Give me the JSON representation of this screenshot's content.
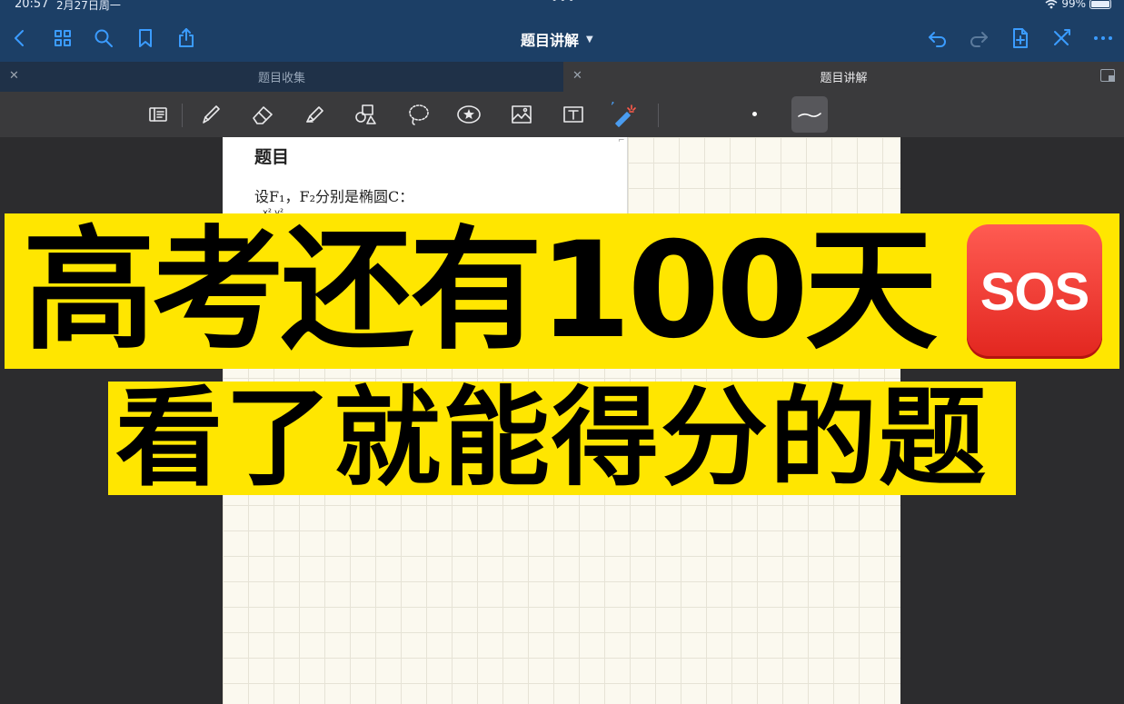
{
  "status_bar": {
    "time": "20:57",
    "date": "2月27日周一",
    "multitask_dots": "•••",
    "battery_percent": "99%"
  },
  "nav": {
    "document_title": "题目讲解",
    "icons": [
      "back-chevron-icon",
      "grid-icon",
      "search-icon",
      "bookmark-icon",
      "share-icon",
      "undo-icon",
      "redo-icon",
      "new-page-icon",
      "close-tools-icon",
      "more-icon"
    ]
  },
  "tabs": [
    {
      "label": "题目收集",
      "active": false
    },
    {
      "label": "题目讲解",
      "active": true
    }
  ],
  "toolbar": {
    "tools": [
      "reader-icon",
      "pen-icon",
      "eraser-icon",
      "highlighter-icon",
      "shapes-icon",
      "lasso-icon",
      "sticker-icon",
      "image-icon",
      "text-icon",
      "laser-pointer-icon"
    ]
  },
  "left_doc": {
    "heading": "题目",
    "question_text": "设F₁，F₂分别是椭圆C：",
    "cut_text": "x²      y²"
  },
  "overlay": {
    "line1": "高考还有100天",
    "sos_label": "SOS",
    "line2": "看了就能得分的题"
  },
  "colors": {
    "nav_bg": "#1c3f66",
    "accent_blue": "#3b9cff",
    "banner_yellow": "#ffe600",
    "sos_red": "#e2261f"
  }
}
